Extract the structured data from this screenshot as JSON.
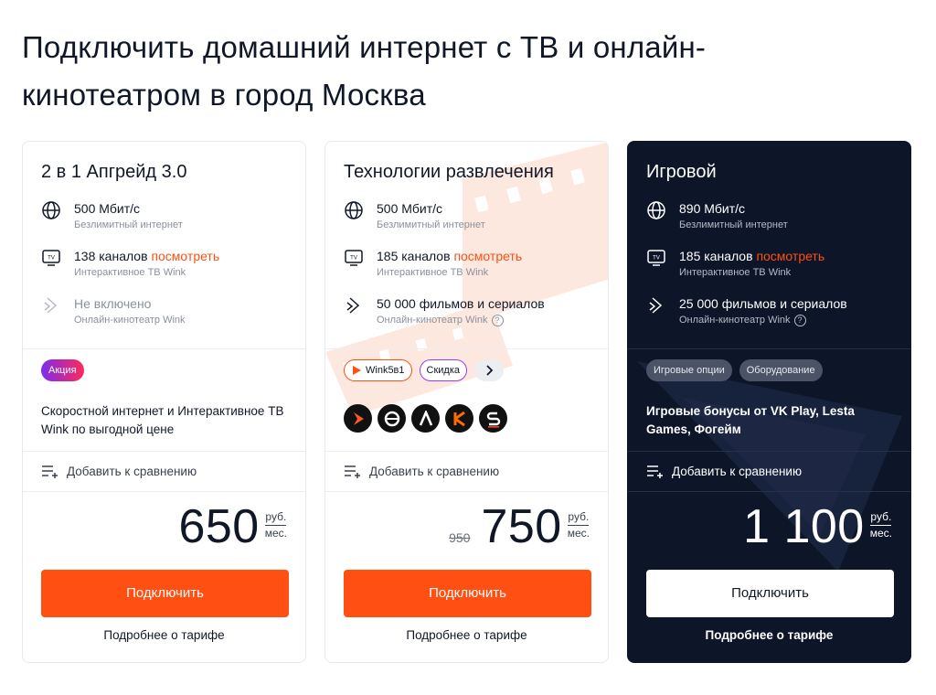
{
  "page": {
    "title": "Подключить домашний интернет с ТВ и онлайн-кинотеатром в город Москва"
  },
  "colors": {
    "accent": "#ff4f12",
    "dark_card": "#0d1528",
    "text": "#101828",
    "muted": "#8a909c"
  },
  "common": {
    "compare_label": "Добавить к сравнению",
    "connect_label": "Подключить",
    "details_label": "Подробнее о тарифе",
    "currency": "руб.",
    "period": "мес.",
    "channels_link": "посмотреть"
  },
  "cards": [
    {
      "title": "2 в 1 Апгрейд 3.0",
      "internet": {
        "speed": "500 Мбит/с",
        "label": "Безлимитный интернет",
        "icon": "globe-icon"
      },
      "tv": {
        "channels": "138 каналов",
        "label": "Интерактивное ТВ Wink",
        "icon": "tv-icon"
      },
      "cinema": {
        "value": "Не включено",
        "label": "Онлайн-кинотеатр Wink",
        "icon": "wink-icon"
      },
      "badge": "Акция",
      "description": "Скоростной интернет и Интерактивное ТВ Wink по выгодной цене",
      "price": "650"
    },
    {
      "title": "Технологии развлечения",
      "internet": {
        "speed": "500 Мбит/с",
        "label": "Безлимитный интернет",
        "icon": "globe-icon"
      },
      "tv": {
        "channels": "185 каналов",
        "label": "Интерактивное ТВ Wink",
        "icon": "tv-icon"
      },
      "cinema": {
        "value": "50 000 фильмов и сериалов",
        "label": "Онлайн-кинотеатр Wink",
        "icon": "wink-icon"
      },
      "chips": [
        "Wink5в1",
        "Скидка"
      ],
      "logos": [
        "wink-logo-icon",
        "start-logo-icon",
        "amediateka-logo-icon",
        "kinopoisk-logo-icon",
        "premier-logo-icon"
      ],
      "old_price": "950",
      "price": "750"
    },
    {
      "title": "Игровой",
      "internet": {
        "speed": "890 Мбит/с",
        "label": "Безлимитный интернет",
        "icon": "globe-icon"
      },
      "tv": {
        "channels": "185 каналов",
        "label": "Интерактивное ТВ Wink",
        "icon": "tv-icon"
      },
      "cinema": {
        "value": "25 000 фильмов и сериалов",
        "label": "Онлайн-кинотеатр Wink",
        "icon": "wink-icon"
      },
      "chips": [
        "Игровые опции",
        "Оборудование"
      ],
      "description": "Игровые бонусы от VK Play, Lesta Games, Фогейм",
      "price": "1 100"
    }
  ]
}
